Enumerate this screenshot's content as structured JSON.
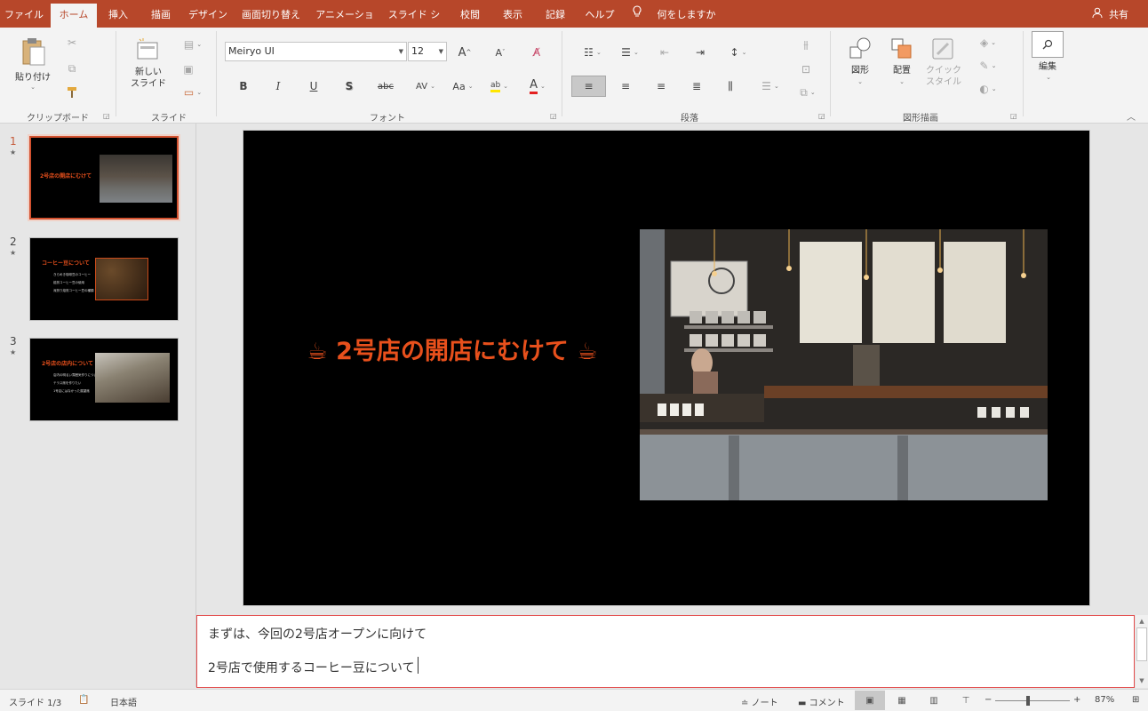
{
  "tabs": [
    "ファイル",
    "ホーム",
    "挿入",
    "描画",
    "デザイン",
    "画面切り替え",
    "アニメーション",
    "スライド ショー",
    "校閲",
    "表示",
    "記録",
    "ヘルプ"
  ],
  "active_tab": "ホーム",
  "tell_me": "何をしますか",
  "share": "共有",
  "ribbon": {
    "clipboard": {
      "label": "クリップボード",
      "paste": "貼り付け"
    },
    "slides": {
      "label": "スライド",
      "new_slide": "新しい\nスライド"
    },
    "font": {
      "label": "フォント",
      "font_name": "Meiryo UI",
      "font_size": "12"
    },
    "paragraph": {
      "label": "段落"
    },
    "drawing": {
      "label": "図形描画",
      "shapes": "図形",
      "arrange": "配置",
      "quick_styles": "クイック\nスタイル"
    },
    "editing": {
      "label": "編集"
    }
  },
  "thumbnails": [
    {
      "num": "1",
      "title": "2号店の開店にむけて",
      "bullets": []
    },
    {
      "num": "2",
      "title": "コーヒー豆について",
      "bullets": [
        "きらめき珈琲豆のコーヒー",
        "焙煎コーヒー豆の使用",
        "深煎り焙煎コーヒー豆の種類"
      ]
    },
    {
      "num": "3",
      "title": "2号店の店内について",
      "bullets": [
        "店内の明るい雰囲気作りについて",
        "テラス席を作りたい",
        "1号店にはなかった展望席"
      ]
    }
  ],
  "slide": {
    "title": "2号店の開店にむけて"
  },
  "notes": [
    "まずは、今回の2号店オープンに向けて",
    "2号店で使用するコーヒー豆について"
  ],
  "status": {
    "slide_count": "スライド 1/3",
    "language": "日本語",
    "notes_btn": "ノート",
    "comments_btn": "コメント",
    "zoom": "87%"
  },
  "colors": {
    "accent": "#b7472a",
    "title": "#e8501c"
  }
}
